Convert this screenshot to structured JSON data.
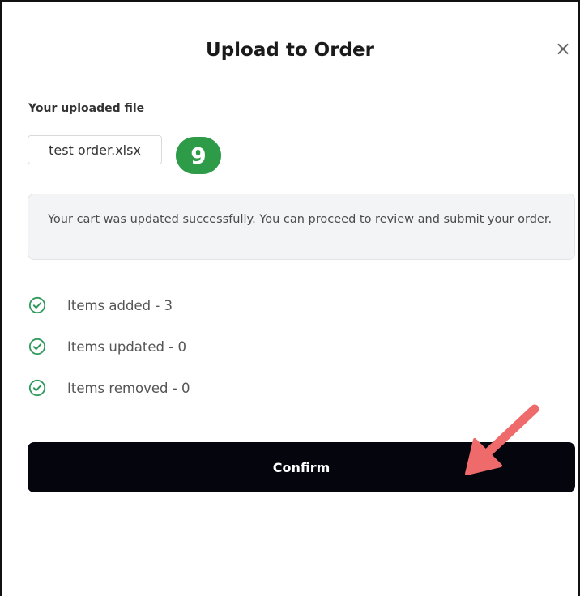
{
  "dialog": {
    "title": "Upload to Order",
    "close_symbol": "×"
  },
  "upload": {
    "label": "Your uploaded file",
    "file_name": "test order.xlsx"
  },
  "step_badge": "9",
  "notice": {
    "message": "Your cart was updated successfully. You can proceed to review and submit your order."
  },
  "stats": [
    {
      "label": "Items added - 3",
      "icon": "check-circle-icon"
    },
    {
      "label": "Items updated - 0",
      "icon": "check-circle-icon"
    },
    {
      "label": "Items removed - 0",
      "icon": "check-circle-icon"
    }
  ],
  "confirm_label": "Confirm",
  "colors": {
    "success": "#2f9a5c",
    "badge": "#2e9b48",
    "button": "#05060d",
    "arrow": "#ef6b6b"
  }
}
